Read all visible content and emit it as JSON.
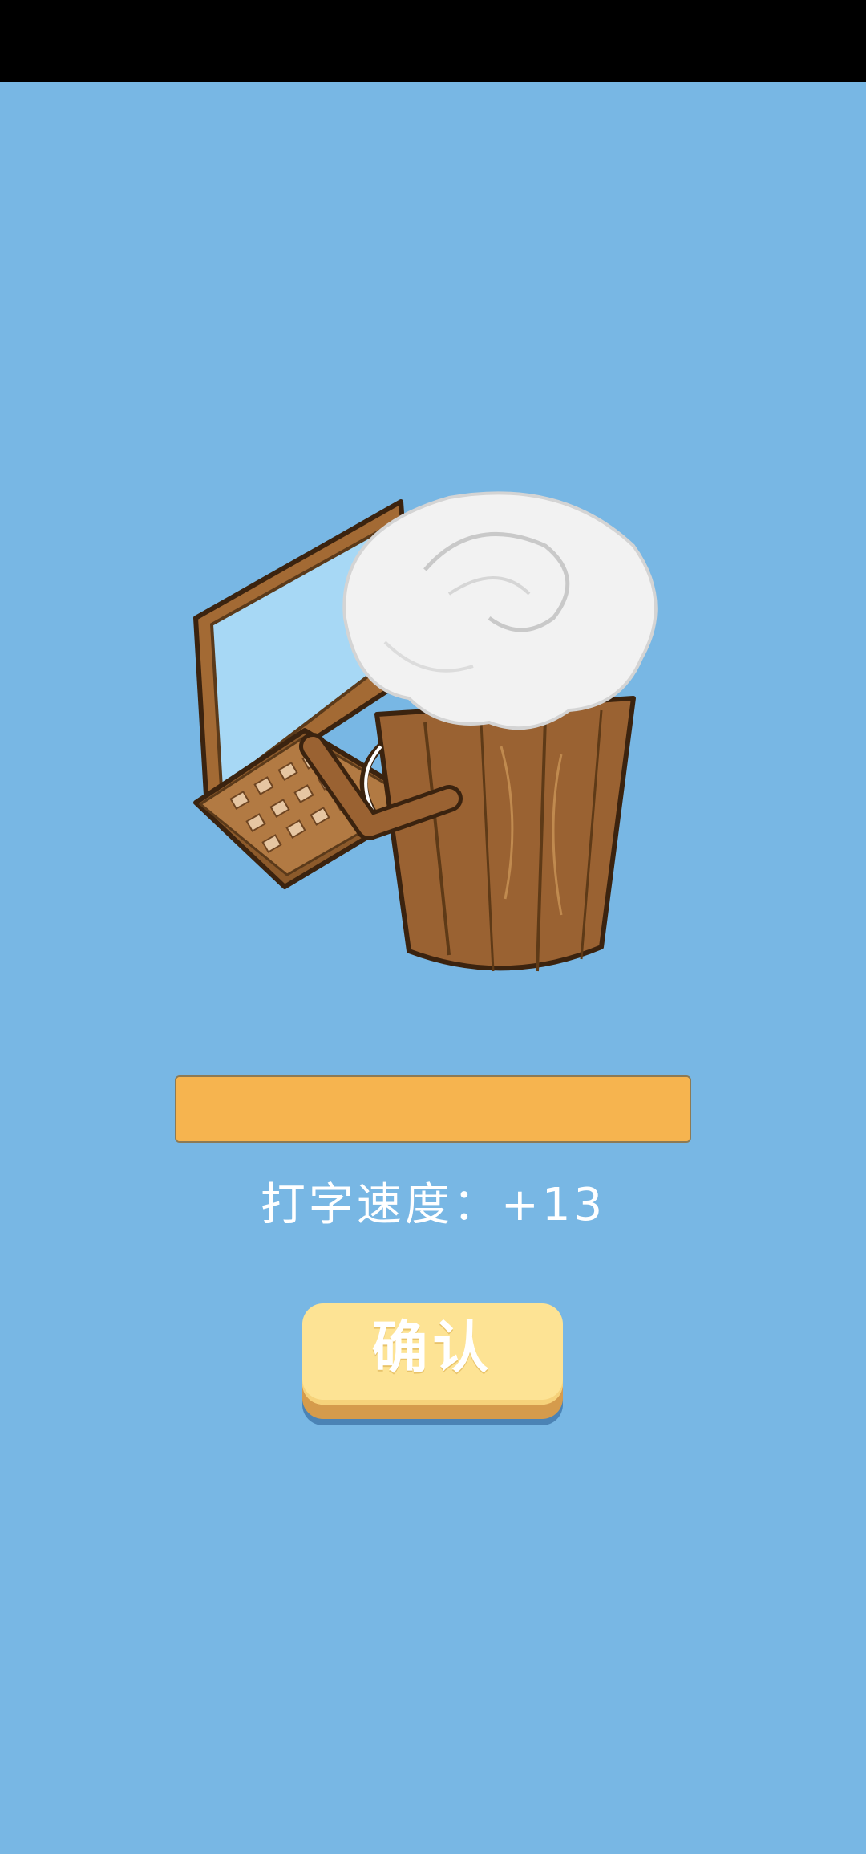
{
  "status_bar": {},
  "item": {
    "icon": "laptop-coffee-cup-icon"
  },
  "progress": {
    "fraction": 1.0,
    "color": "#f6b44f"
  },
  "stat": {
    "text": "打字速度：+13"
  },
  "confirm_button": {
    "label": "确认",
    "face_color": "#fde394"
  },
  "background_color": "#78b7e4"
}
